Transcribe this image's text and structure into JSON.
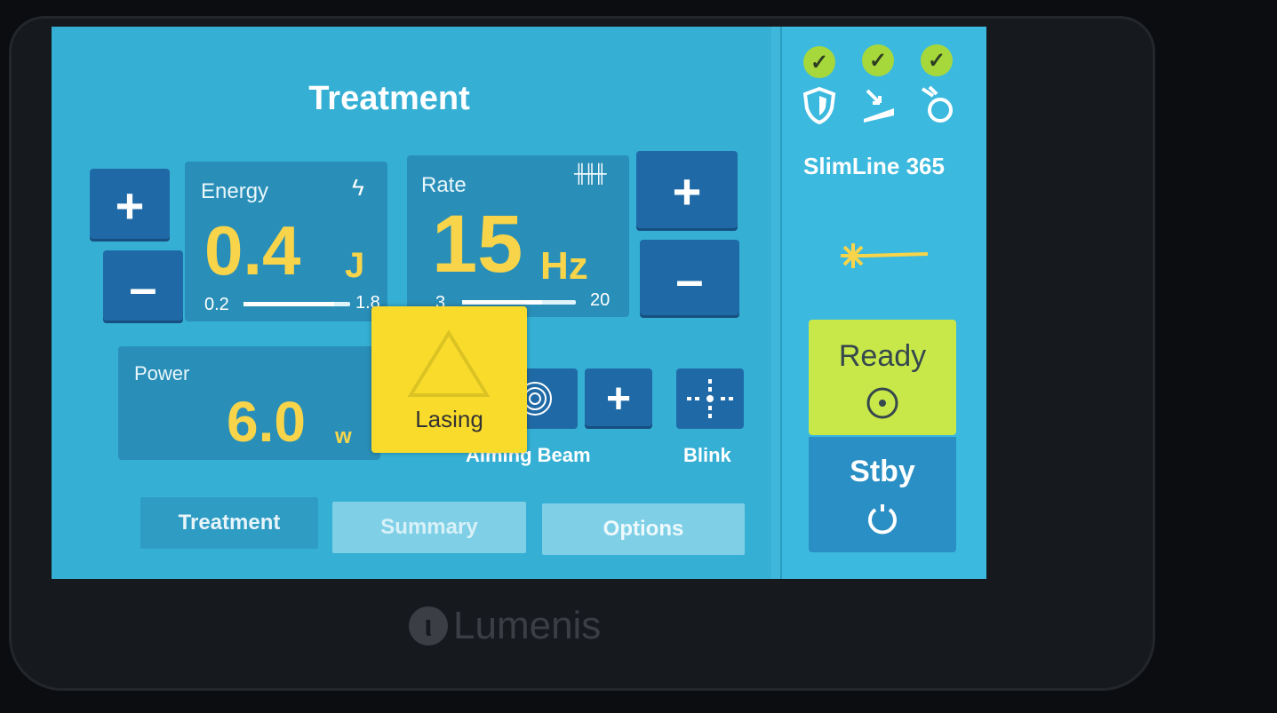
{
  "screen_title": "Treatment",
  "energy": {
    "label": "Energy",
    "value": "0.4",
    "unit": "J",
    "min": "0.2",
    "max": "1.8",
    "level": 0.85,
    "increase_label": "+",
    "decrease_label": "–"
  },
  "rate": {
    "label": "Rate",
    "value": "15",
    "unit": "Hz",
    "min": "3",
    "max": "20",
    "level": 0.7,
    "increase_label": "+",
    "decrease_label": "–"
  },
  "power": {
    "label": "Power",
    "value": "6.0",
    "unit": "w"
  },
  "lasing_label": "Lasing",
  "aiming_beam_label": "Aiming Beam",
  "aiming_increase_label": "+",
  "blink_label": "Blink",
  "tabs": [
    {
      "label": "Treatment",
      "active": true
    },
    {
      "label": "Summary",
      "active": false
    },
    {
      "label": "Options",
      "active": false
    }
  ],
  "status_checks": [
    "shield",
    "footswitch",
    "fiber"
  ],
  "fiber_name": "SlimLine 365",
  "ready_label": "Ready",
  "standby_label": "Stby",
  "brand": "Lumenis",
  "colors": {
    "accent": "#f7d44a",
    "ready": "#c8e84a",
    "lasing": "#f9dc2b",
    "button": "#1f6aa6"
  }
}
